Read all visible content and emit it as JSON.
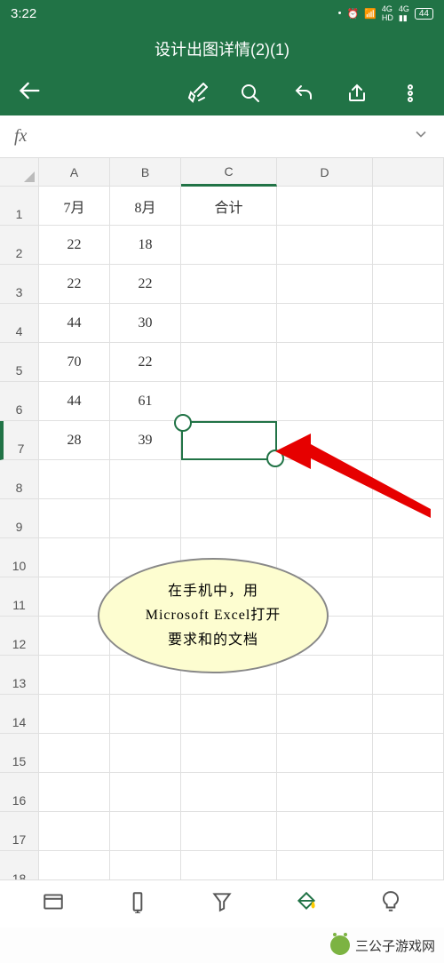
{
  "status": {
    "time": "3:22",
    "battery": "44"
  },
  "header": {
    "title": "设计出图详情(2)(1)"
  },
  "formula": {
    "fx": "fx"
  },
  "columns": [
    "A",
    "B",
    "C",
    "D"
  ],
  "rows": [
    "1",
    "2",
    "3",
    "4",
    "5",
    "6",
    "7",
    "8",
    "9",
    "10",
    "11",
    "12",
    "13",
    "14",
    "15",
    "16",
    "17",
    "18"
  ],
  "cells": {
    "A1": "7月",
    "B1": "8月",
    "C1": "合计",
    "A2": "22",
    "B2": "18",
    "A3": "22",
    "B3": "22",
    "A4": "44",
    "B4": "30",
    "A5": "70",
    "B5": "22",
    "A6": "44",
    "B6": "61",
    "A7": "28",
    "B7": "39"
  },
  "selection": {
    "cell": "C7"
  },
  "callout": {
    "line1": "在手机中，用",
    "line2": "Microsoft Excel打开",
    "line3": "要求和的文档"
  },
  "watermark": {
    "text": "三公子游戏网"
  }
}
